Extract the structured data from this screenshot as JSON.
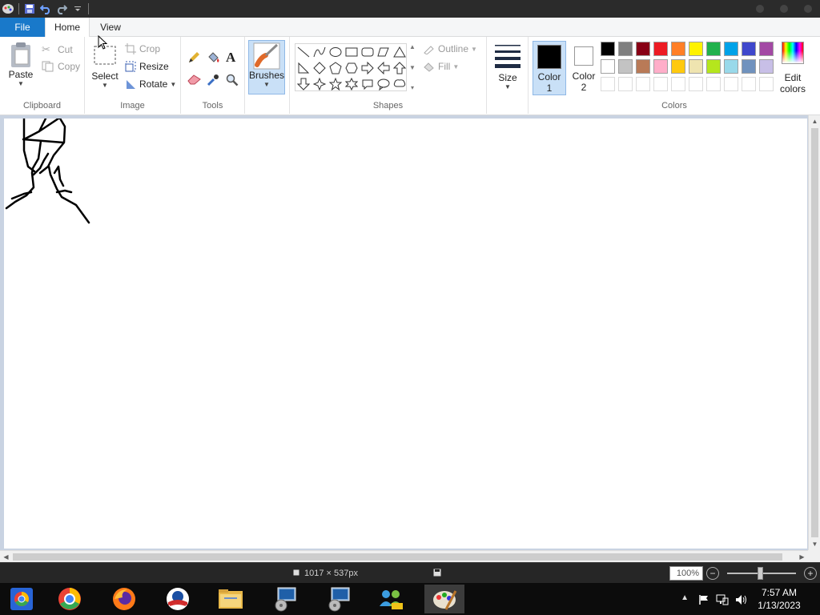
{
  "qat": {
    "icons": [
      "paint-app-icon",
      "save-icon",
      "undo-icon",
      "redo-icon",
      "customize-qat-icon"
    ]
  },
  "tabs": [
    {
      "label": "File"
    },
    {
      "label": "Home"
    },
    {
      "label": "View"
    }
  ],
  "clipboard": {
    "paste": "Paste",
    "cut": "Cut",
    "copy": "Copy",
    "group_label": "Clipboard"
  },
  "image": {
    "select": "Select",
    "crop": "Crop",
    "resize": "Resize",
    "rotate": "Rotate",
    "group_label": "Image"
  },
  "tools": {
    "group_label": "Tools",
    "text_glyph": "A"
  },
  "brushes": {
    "label": "Brushes"
  },
  "shapes": {
    "outline": "Outline",
    "fill": "Fill",
    "group_label": "Shapes"
  },
  "size": {
    "label": "Size"
  },
  "color1": {
    "label_line1": "Color",
    "label_line2": "1",
    "value": "#000000"
  },
  "color2": {
    "label_line1": "Color",
    "label_line2": "2",
    "value": "#ffffff"
  },
  "colors": {
    "group_label": "Colors",
    "edit_line1": "Edit",
    "edit_line2": "colors",
    "row1": [
      "#000000",
      "#7f7f7f",
      "#880015",
      "#ed1c24",
      "#ff7f27",
      "#fff200",
      "#22b14c",
      "#00a2e8",
      "#3f48cc",
      "#a349a4"
    ],
    "row2": [
      "#ffffff",
      "#c3c3c3",
      "#b97a57",
      "#ffaec9",
      "#ffc90e",
      "#efe4b0",
      "#b5e61d",
      "#99d9ea",
      "#7092be",
      "#c8bfe7"
    ]
  },
  "status": {
    "canvas_size": "1017 × 537px",
    "zoom": "100%"
  },
  "taskbar": {
    "apps": [
      "chrome-remote-icon",
      "chrome-icon",
      "firefox-icon",
      "obama-app-icon",
      "file-explorer-icon",
      "installer-icon",
      "installer-icon-2",
      "people-icon",
      "paint-icon"
    ]
  },
  "clock": {
    "time": "7:57 AM",
    "date": "1/13/2023"
  }
}
